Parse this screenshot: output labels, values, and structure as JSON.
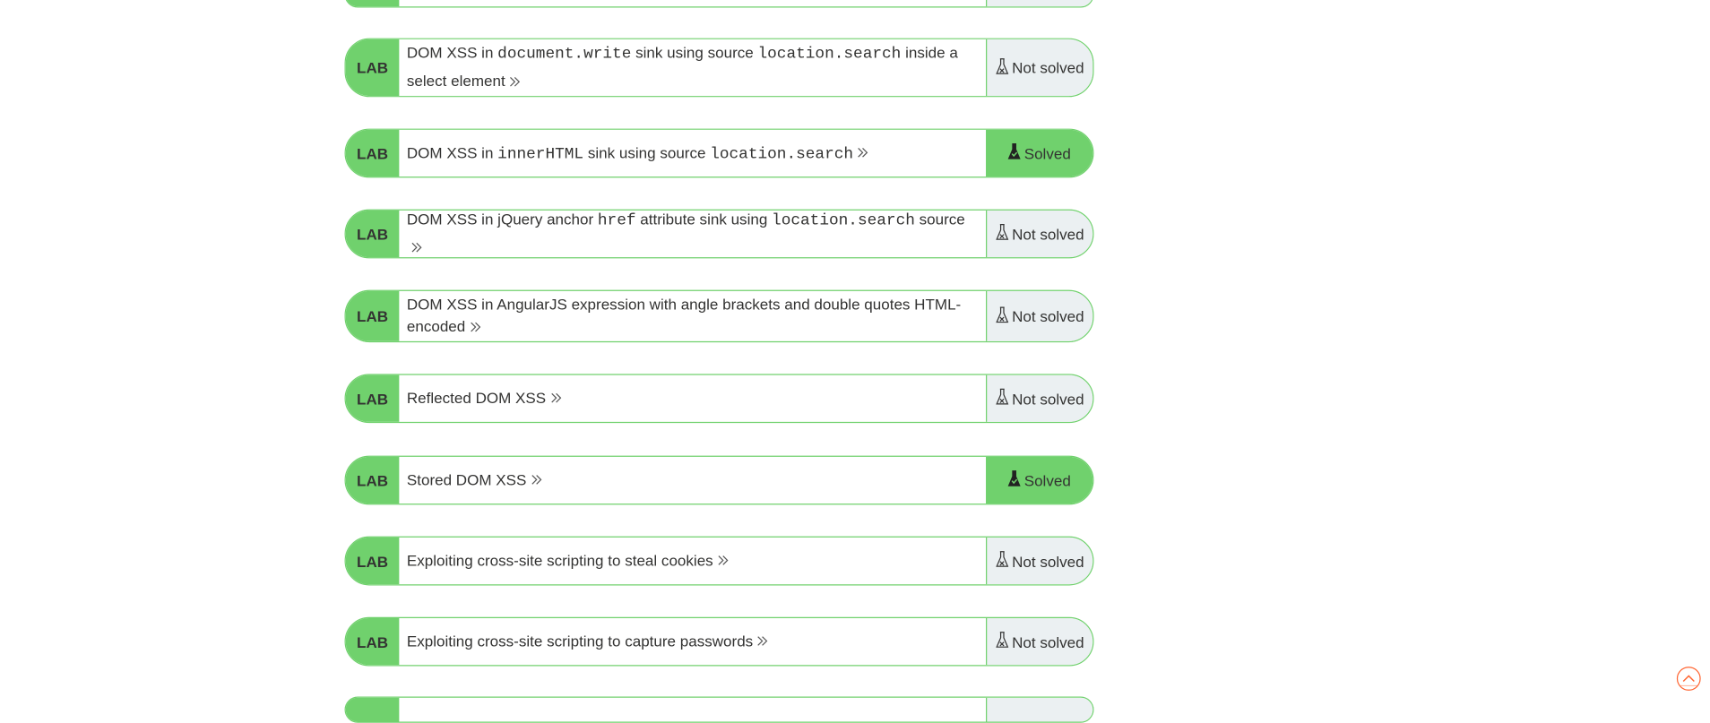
{
  "labs": [
    {
      "badge": "LAB",
      "parts": [
        "DOM XSS in ",
        "document.write",
        " sink using source ",
        "location.search",
        " inside a select element"
      ],
      "status": "Not solved",
      "solved": false
    },
    {
      "badge": "LAB",
      "parts": [
        "DOM XSS in ",
        "innerHTML",
        " sink using source ",
        "location.search",
        ""
      ],
      "status": "Solved",
      "solved": true
    },
    {
      "badge": "LAB",
      "parts": [
        "DOM XSS in jQuery anchor ",
        "href",
        " attribute sink using ",
        "location.search",
        " source"
      ],
      "status": "Not solved",
      "solved": false
    },
    {
      "badge": "LAB",
      "parts": [
        "DOM XSS in AngularJS expression with angle brackets and double quotes HTML-encoded"
      ],
      "status": "Not solved",
      "solved": false
    },
    {
      "badge": "LAB",
      "parts": [
        "Reflected DOM XSS"
      ],
      "status": "Not solved",
      "solved": false
    },
    {
      "badge": "LAB",
      "parts": [
        "Stored DOM XSS"
      ],
      "status": "Solved",
      "solved": true
    },
    {
      "badge": "LAB",
      "parts": [
        "Exploiting cross-site scripting to steal cookies"
      ],
      "status": "Not solved",
      "solved": false
    },
    {
      "badge": "LAB",
      "parts": [
        "Exploiting cross-site scripting to capture passwords"
      ],
      "status": "Not solved",
      "solved": false
    }
  ],
  "icons": {
    "link_arrow": "double-chevron-right-icon",
    "not_solved": "flask-outline-icon",
    "solved": "flask-filled-icon",
    "scroll_top": "scroll-to-top-icon"
  },
  "colors": {
    "accent_green": "#70d16d",
    "not_solved_bg": "#ebf0f2",
    "text": "#333332",
    "scroll_top_orange": "#ff6633"
  }
}
